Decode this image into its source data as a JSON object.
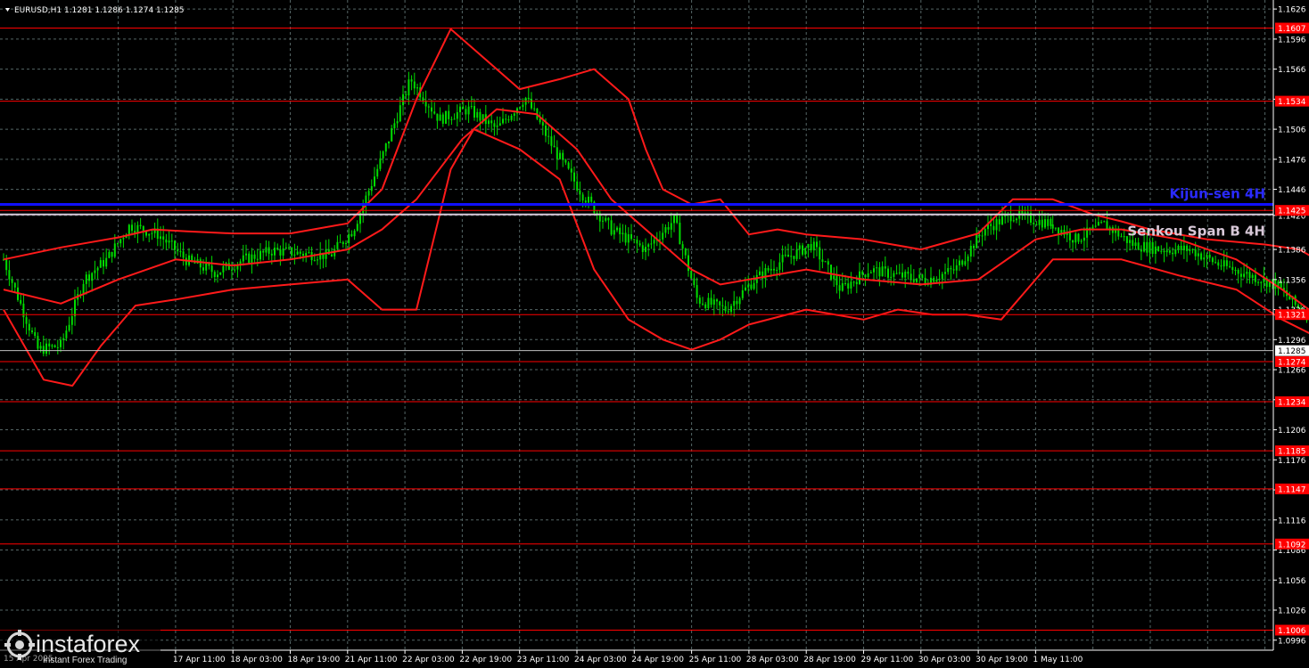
{
  "chart_data": {
    "type": "line",
    "title": "EURUSD,H1  1.1281 1.1286 1.1274 1.1285",
    "symbol": "EURUSD,H1",
    "ohlc": "1.1281 1.1286 1.1274 1.1285",
    "ylim": [
      1.0986,
      1.1635
    ],
    "y_ticks": [
      "1.1626",
      "1.1596",
      "1.1566",
      "1.1536",
      "1.1506",
      "1.1476",
      "1.1446",
      "1.1420",
      "1.1386",
      "1.1356",
      "1.1326",
      "1.1296",
      "1.1266",
      "1.1236",
      "1.1206",
      "1.1176",
      "1.1146",
      "1.1116",
      "1.1086",
      "1.1056",
      "1.1026",
      "1.0996"
    ],
    "x_ticks": [
      "17 Apr 11:00",
      "18 Apr 03:00",
      "18 Apr 19:00",
      "21 Apr 11:00",
      "22 Apr 03:00",
      "22 Apr 19:00",
      "23 Apr 11:00",
      "24 Apr 03:00",
      "24 Apr 19:00",
      "25 Apr 11:00",
      "28 Apr 03:00",
      "28 Apr 19:00",
      "29 Apr 11:00",
      "30 Apr 03:00",
      "30 Apr 19:00",
      "1 May 11:00"
    ],
    "levels": [
      {
        "value": 1.1607,
        "label": "1.1607",
        "color": "#ff0000"
      },
      {
        "value": 1.1534,
        "label": "1.1534",
        "color": "#ff0000"
      },
      {
        "value": 1.1425,
        "label": "1.1425",
        "color": "#ff0000"
      },
      {
        "value": 1.1321,
        "label": "1.1321",
        "color": "#ff0000"
      },
      {
        "value": 1.1274,
        "label": "1.1274",
        "color": "#ff0000"
      },
      {
        "value": 1.1234,
        "label": "1.1234",
        "color": "#ff0000"
      },
      {
        "value": 1.1185,
        "label": "1.1185",
        "color": "#ff0000"
      },
      {
        "value": 1.1147,
        "label": "1.1147",
        "color": "#ff0000"
      },
      {
        "value": 1.1092,
        "label": "1.1092",
        "color": "#ff0000"
      },
      {
        "value": 1.1006,
        "label": "1.1006",
        "color": "#ff0000"
      }
    ],
    "current_price": {
      "value": 1.1285,
      "label": "1.1285"
    },
    "kijun_sen": {
      "value": 1.1431,
      "label": "Kijun-sen 4H",
      "color": "#1010ff"
    },
    "senkou_span_b": {
      "value": 1.1421,
      "label": "Senkou Span B 4H",
      "color": "#d8c8d8"
    },
    "series": [
      {
        "type": "price",
        "color": "#00dd00",
        "x": [
          0,
          0.6,
          1.0,
          1.4,
          1.8,
          2.2,
          2.7,
          3.2,
          3.7,
          4.2,
          4.7,
          5.2,
          5.7,
          6.1,
          6.6,
          7.1,
          7.6,
          8.1,
          8.6,
          9.1,
          9.6,
          10.1,
          10.6,
          11.2,
          11.7,
          12.1,
          12.6,
          13.1,
          13.6,
          14.1,
          14.6,
          15.1,
          15.6,
          16.1,
          16.6,
          17.1,
          17.6,
          18.3
        ],
        "y": [
          1.1376,
          1.1286,
          1.129,
          1.1356,
          1.1376,
          1.141,
          1.1401,
          1.1375,
          1.1363,
          1.1376,
          1.1385,
          1.1382,
          1.138,
          1.1406,
          1.1478,
          1.1556,
          1.1516,
          1.1526,
          1.1506,
          1.1538,
          1.1486,
          1.1441,
          1.1406,
          1.1386,
          1.1416,
          1.1336,
          1.1326,
          1.1356,
          1.1376,
          1.1391,
          1.1346,
          1.1366,
          1.136,
          1.1356,
          1.1366,
          1.1406,
          1.1421,
          1.1411
        ]
      },
      {
        "type": "price",
        "color": "#00dd00",
        "x": [
          18.3,
          18.7,
          19.2,
          19.7,
          20.2,
          20.7,
          21.2,
          21.7,
          22.2,
          22.6,
          23.0,
          23.3,
          23.6,
          23.8,
          24.0,
          24.2
        ],
        "y": [
          1.1411,
          1.1396,
          1.1411,
          1.1391,
          1.1386,
          1.1386,
          1.1371,
          1.1361,
          1.1351,
          1.1326,
          1.1311,
          1.1306,
          1.1316,
          1.1326,
          1.1286,
          1.1281
        ]
      },
      {
        "type": "bollinger_upper",
        "color": "#ff1a1a",
        "x": [
          0,
          1.0,
          2.0,
          2.6,
          3.2,
          4.0,
          5.0,
          6.0,
          6.6,
          7.2,
          7.8,
          8.2,
          9.0,
          9.7,
          10.3,
          10.9,
          11.2,
          11.5,
          12.0,
          12.5,
          13.0,
          13.5,
          14.0,
          15.0,
          16.0,
          17.0,
          17.6,
          18.3,
          19.0,
          19.5,
          20.0,
          21.0,
          22.0,
          22.6,
          23.2,
          23.6,
          24.3
        ],
        "y": [
          1.1376,
          1.1388,
          1.1398,
          1.1406,
          1.1404,
          1.1402,
          1.1402,
          1.1412,
          1.1446,
          1.1536,
          1.1606,
          1.1586,
          1.1546,
          1.1556,
          1.1566,
          1.1536,
          1.1486,
          1.1446,
          1.1431,
          1.1436,
          1.1401,
          1.1406,
          1.1401,
          1.1396,
          1.1386,
          1.1402,
          1.1436,
          1.1436,
          1.1421,
          1.1414,
          1.1406,
          1.1396,
          1.1391,
          1.1386,
          1.1366,
          1.1346,
          1.1346
        ]
      },
      {
        "type": "bollinger_lower",
        "color": "#ff1a1a",
        "x": [
          0,
          0.7,
          1.2,
          1.7,
          2.3,
          3.0,
          4.0,
          5.0,
          6.0,
          6.6,
          7.2,
          7.8,
          8.2,
          9.0,
          9.7,
          10.3,
          10.9,
          11.5,
          12.0,
          12.5,
          13.0,
          14.0,
          15.0,
          15.6,
          16.2,
          16.8,
          17.4,
          18.3,
          18.8,
          19.5,
          20.5,
          21.5,
          22.3,
          23.0,
          23.6
        ],
        "y": [
          1.1326,
          1.1256,
          1.125,
          1.129,
          1.133,
          1.1336,
          1.1346,
          1.1351,
          1.1356,
          1.1326,
          1.1326,
          1.1466,
          1.1506,
          1.1486,
          1.1456,
          1.1366,
          1.1316,
          1.1296,
          1.1286,
          1.1296,
          1.1311,
          1.1326,
          1.1316,
          1.1326,
          1.1321,
          1.1321,
          1.1316,
          1.1376,
          1.1376,
          1.1376,
          1.136,
          1.1346,
          1.1316,
          1.1296,
          1.1286
        ]
      },
      {
        "type": "bollinger_mid",
        "color": "#ff1a1a",
        "x": [
          0,
          1.0,
          2.0,
          3.0,
          4.0,
          5.0,
          6.0,
          6.6,
          7.2,
          8.0,
          8.6,
          9.3,
          10.0,
          10.6,
          11.2,
          12.0,
          12.5,
          13.0,
          14.0,
          15.0,
          16.0,
          17.0,
          18.0,
          18.8,
          19.5,
          20.5,
          21.5,
          22.3,
          23.0,
          23.6
        ],
        "y": [
          1.1346,
          1.1332,
          1.1356,
          1.1376,
          1.137,
          1.1376,
          1.1386,
          1.1406,
          1.1436,
          1.1496,
          1.1526,
          1.1521,
          1.1486,
          1.1436,
          1.1406,
          1.1366,
          1.1351,
          1.1356,
          1.1366,
          1.1356,
          1.1351,
          1.1356,
          1.1396,
          1.1406,
          1.1406,
          1.1396,
          1.1376,
          1.1346,
          1.1316,
          1.1296
        ]
      }
    ],
    "grid": true,
    "legend": "none"
  },
  "brand": {
    "name": "instaforex",
    "tagline": "Instant Forex Trading",
    "x_tick_partial": "15 Apr 2025"
  },
  "colors": {
    "background": "#000000",
    "grid": "#5a6a6a",
    "price": "#00dd00",
    "band": "#ff1a1a",
    "level": "#ff0000",
    "kijun": "#1010ff"
  }
}
